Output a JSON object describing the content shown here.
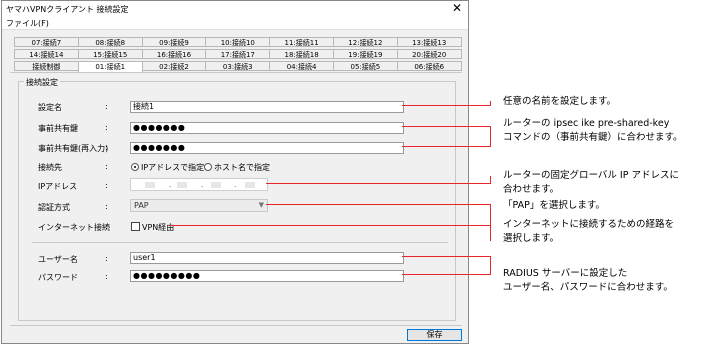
{
  "window": {
    "title": "ヤマハVPNクライアント 接続設定",
    "close_glyph": "✕"
  },
  "menu": {
    "file": "ファイル(F)"
  },
  "tabs_row1": [
    "07:接続7",
    "08:接続8",
    "09:接続9",
    "10:接続10",
    "11:接続11",
    "12:接続12",
    "13:接続13"
  ],
  "tabs_row2": [
    "14:接続14",
    "15:接続15",
    "16:接続16",
    "17:接続17",
    "18:接続18",
    "19:接続19",
    "20:接続20"
  ],
  "tabs_row3": [
    "接続制御",
    "01:接続1",
    "02:接続2",
    "03:接続3",
    "04:接続4",
    "05:接続5",
    "06:接続6"
  ],
  "group_title": "接続設定",
  "form": {
    "name_label": "設定名",
    "name_value": "接続1",
    "psk_label": "事前共有鍵",
    "psk_value": "●●●●●●●",
    "psk2_label": "事前共有鍵(再入力)",
    "psk2_value": "●●●●●●●",
    "dest_label": "接続先",
    "dest_opt1": "IPアドレスで指定",
    "dest_opt2": "ホスト名で指定",
    "ip_label": "IPアドレス",
    "auth_label": "認証方式",
    "auth_value": "PAP",
    "inet_label": "インターネット接続",
    "inet_opt": "VPN経由",
    "user_label": "ユーザー名",
    "user_value": "user1",
    "pass_label": "パスワード",
    "pass_value": "●●●●●●●●●"
  },
  "colon": ":",
  "save_label": "保存",
  "annotations": {
    "a1": "任意の名前を設定します。",
    "a2_l1": "ルーターの ipsec ike pre-shared-key",
    "a2_l2": "コマンドの（事前共有鍵）に合わせます。",
    "a3_l1": "ルーターの固定グローバル IP アドレスに",
    "a3_l2": "合わせます。",
    "a4": "「PAP」を選択します。",
    "a5_l1": "インターネットに接続するための経路を",
    "a5_l2": "選択します。",
    "a6_l1": "RADIUS サーバーに設定した",
    "a6_l2": "ユーザー名、パスワードに合わせます。"
  },
  "colors": {
    "annotation_line": "#e8262a",
    "window_bg": "#f0f0f0"
  }
}
